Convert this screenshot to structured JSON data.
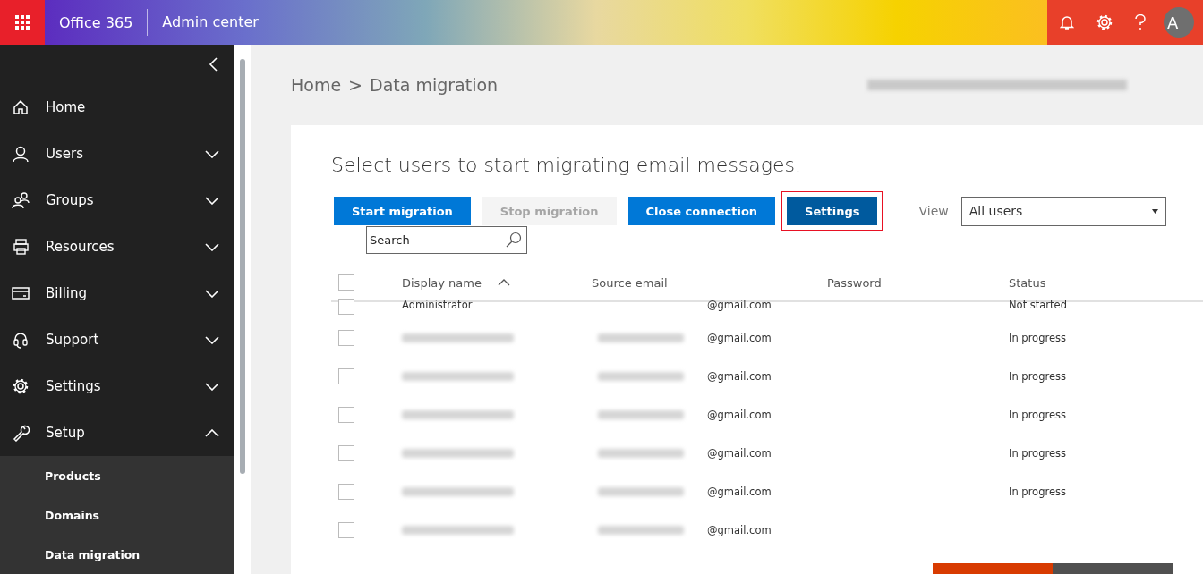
{
  "header": {
    "app_name": "Office 365",
    "section": "Admin center",
    "avatar_initial": "A"
  },
  "sidebar": {
    "items": [
      {
        "label": "Home",
        "kind": "link"
      },
      {
        "label": "Users",
        "kind": "group",
        "expanded": false
      },
      {
        "label": "Groups",
        "kind": "group",
        "expanded": false
      },
      {
        "label": "Resources",
        "kind": "group",
        "expanded": false
      },
      {
        "label": "Billing",
        "kind": "group",
        "expanded": false
      },
      {
        "label": "Support",
        "kind": "group",
        "expanded": false
      },
      {
        "label": "Settings",
        "kind": "group",
        "expanded": false
      },
      {
        "label": "Setup",
        "kind": "group",
        "expanded": true,
        "children": [
          {
            "label": "Products"
          },
          {
            "label": "Domains"
          },
          {
            "label": "Data migration"
          }
        ]
      }
    ]
  },
  "breadcrumb": {
    "items": [
      "Home",
      "Data migration"
    ],
    "separator": ">"
  },
  "heading": "Select users to start migrating email messages.",
  "toolbar": {
    "buttons": [
      {
        "label": "Start migration",
        "kind": "primary"
      },
      {
        "label": "Stop migration",
        "kind": "disabled"
      },
      {
        "label": "Close connection",
        "kind": "primary"
      },
      {
        "label": "Settings",
        "kind": "focused"
      }
    ],
    "view_label": "View",
    "view_value": "All users",
    "search": {
      "placeholder": "Search"
    }
  },
  "table": {
    "columns": [
      {
        "label": "Display name",
        "sorted": true
      },
      {
        "label": "Source email"
      },
      {
        "label": "Password"
      },
      {
        "label": "Status"
      }
    ],
    "header_checked": false,
    "rows": [
      {
        "display_name": "Administrator",
        "redacted": false,
        "source_email": "@gmail.com",
        "status": "Not started",
        "checked": false
      },
      {
        "redacted": true,
        "source_email": "@gmail.com",
        "status": "In progress",
        "checked": false
      },
      {
        "redacted": true,
        "source_email": "@gmail.com",
        "status": "In progress",
        "checked": false
      },
      {
        "redacted": true,
        "source_email": "@gmail.com",
        "status": "In progress",
        "checked": false
      },
      {
        "redacted": true,
        "source_email": "@gmail.com",
        "status": "In progress",
        "checked": false
      },
      {
        "redacted": true,
        "source_email": "@gmail.com",
        "status": "In progress",
        "checked": false
      },
      {
        "redacted": true,
        "source_email": "@gmail.com",
        "checked": false
      }
    ]
  }
}
